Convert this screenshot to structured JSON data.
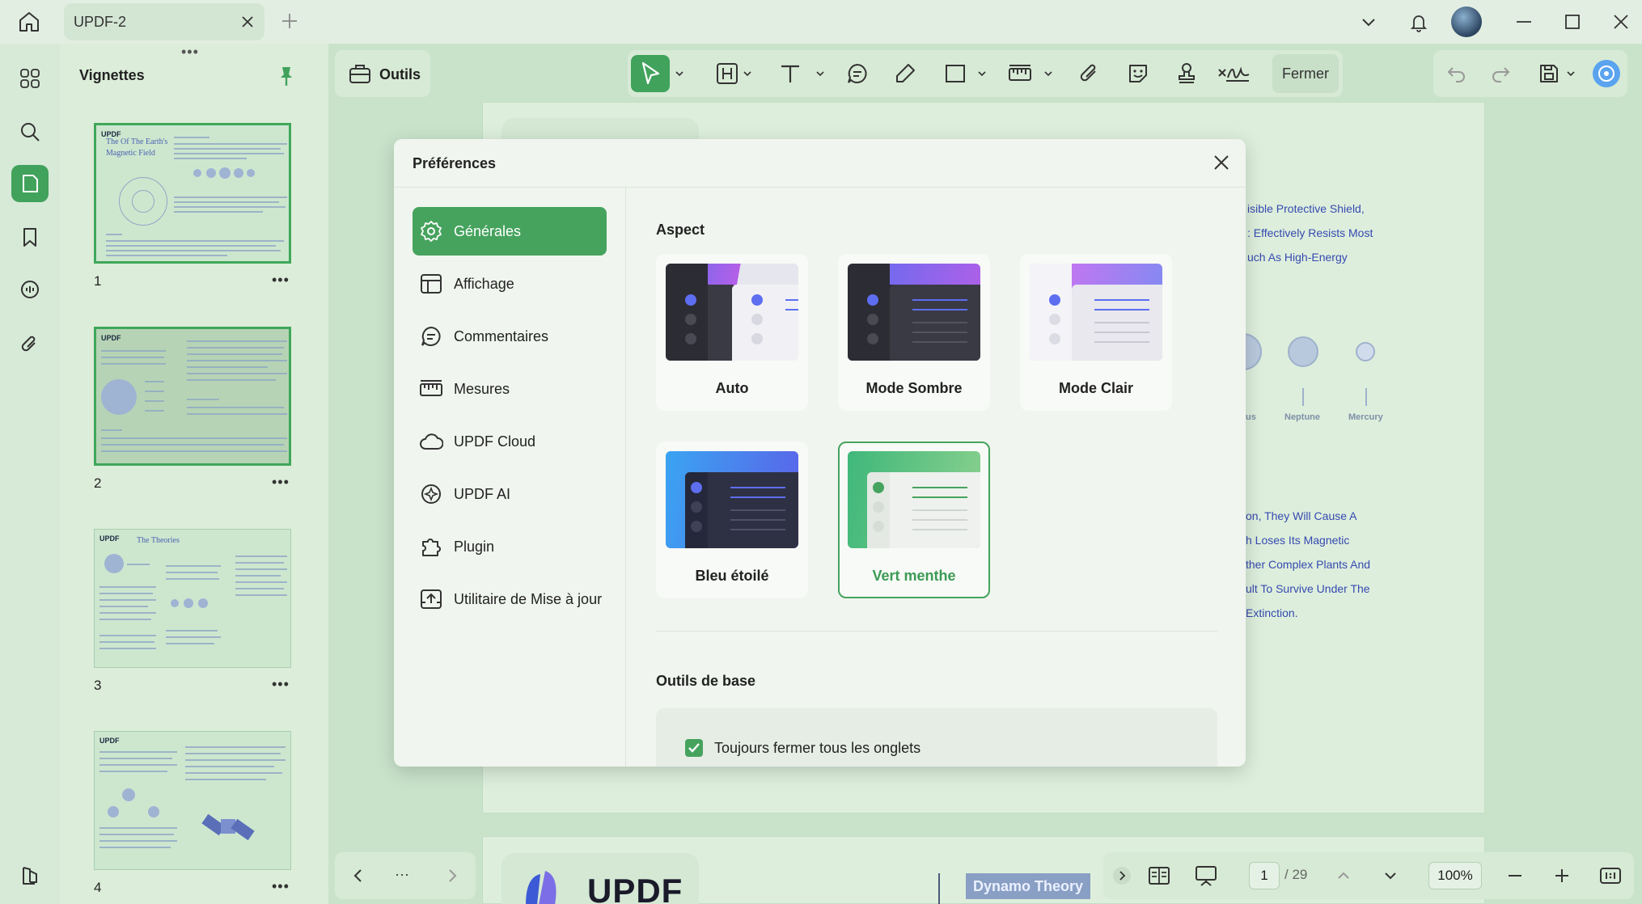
{
  "app": {
    "tab_title": "UPDF-2"
  },
  "thumbnails": {
    "title": "Vignettes",
    "handle": "•••",
    "more": "•••",
    "pages": [
      {
        "number": "1",
        "logo": "UPDF",
        "heading": "The Of The Earth's Magnetic Field"
      },
      {
        "number": "2",
        "logo": "UPDF",
        "heading": ""
      },
      {
        "number": "3",
        "logo": "UPDF",
        "heading": "The Theories"
      },
      {
        "number": "4",
        "logo": "UPDF",
        "heading": ""
      }
    ]
  },
  "toolbar": {
    "tools_label": "Outils",
    "close_label": "Fermer"
  },
  "document": {
    "lines": [
      "isible Protective Shield,",
      ": Effectively Resists Most",
      "uch As High-Energy",
      "on, They Will Cause A",
      "h Loses Its Magnetic",
      "ther Complex Plants And",
      "ult To Survive Under The",
      "Extinction."
    ],
    "planet_labels": [
      "us",
      "Neptune",
      "Mercury"
    ],
    "logo_text": "UPDF",
    "badge_text": "Dynamo Theory"
  },
  "statusbar": {
    "page_current": "1",
    "page_total": "/ 29",
    "zoom": "100%",
    "more": "···"
  },
  "preferences": {
    "title": "Préférences",
    "nav": [
      {
        "label": "Générales",
        "icon": "gear-icon",
        "active": true
      },
      {
        "label": "Affichage",
        "icon": "layout-icon",
        "active": false
      },
      {
        "label": "Commentaires",
        "icon": "comment-icon",
        "active": false
      },
      {
        "label": "Mesures",
        "icon": "ruler-icon",
        "active": false
      },
      {
        "label": "UPDF Cloud",
        "icon": "cloud-icon",
        "active": false
      },
      {
        "label": "UPDF AI",
        "icon": "ai-icon",
        "active": false
      },
      {
        "label": "Plugin",
        "icon": "puzzle-icon",
        "active": false
      },
      {
        "label": "Utilitaire de Mise à jour",
        "icon": "update-icon",
        "active": false
      }
    ],
    "aspect_title": "Aspect",
    "themes": [
      {
        "label": "Auto",
        "selected": false
      },
      {
        "label": "Mode Sombre",
        "selected": false
      },
      {
        "label": "Mode Clair",
        "selected": false
      },
      {
        "label": "Bleu étoilé",
        "selected": false
      },
      {
        "label": "Vert menthe",
        "selected": true
      }
    ],
    "basic_tools_title": "Outils de base",
    "close_all_tabs_label": "Toujours fermer tous les onglets",
    "close_all_tabs_checked": true
  },
  "colors": {
    "accent": "#46a35e",
    "canvas": "#c9e3cb"
  }
}
